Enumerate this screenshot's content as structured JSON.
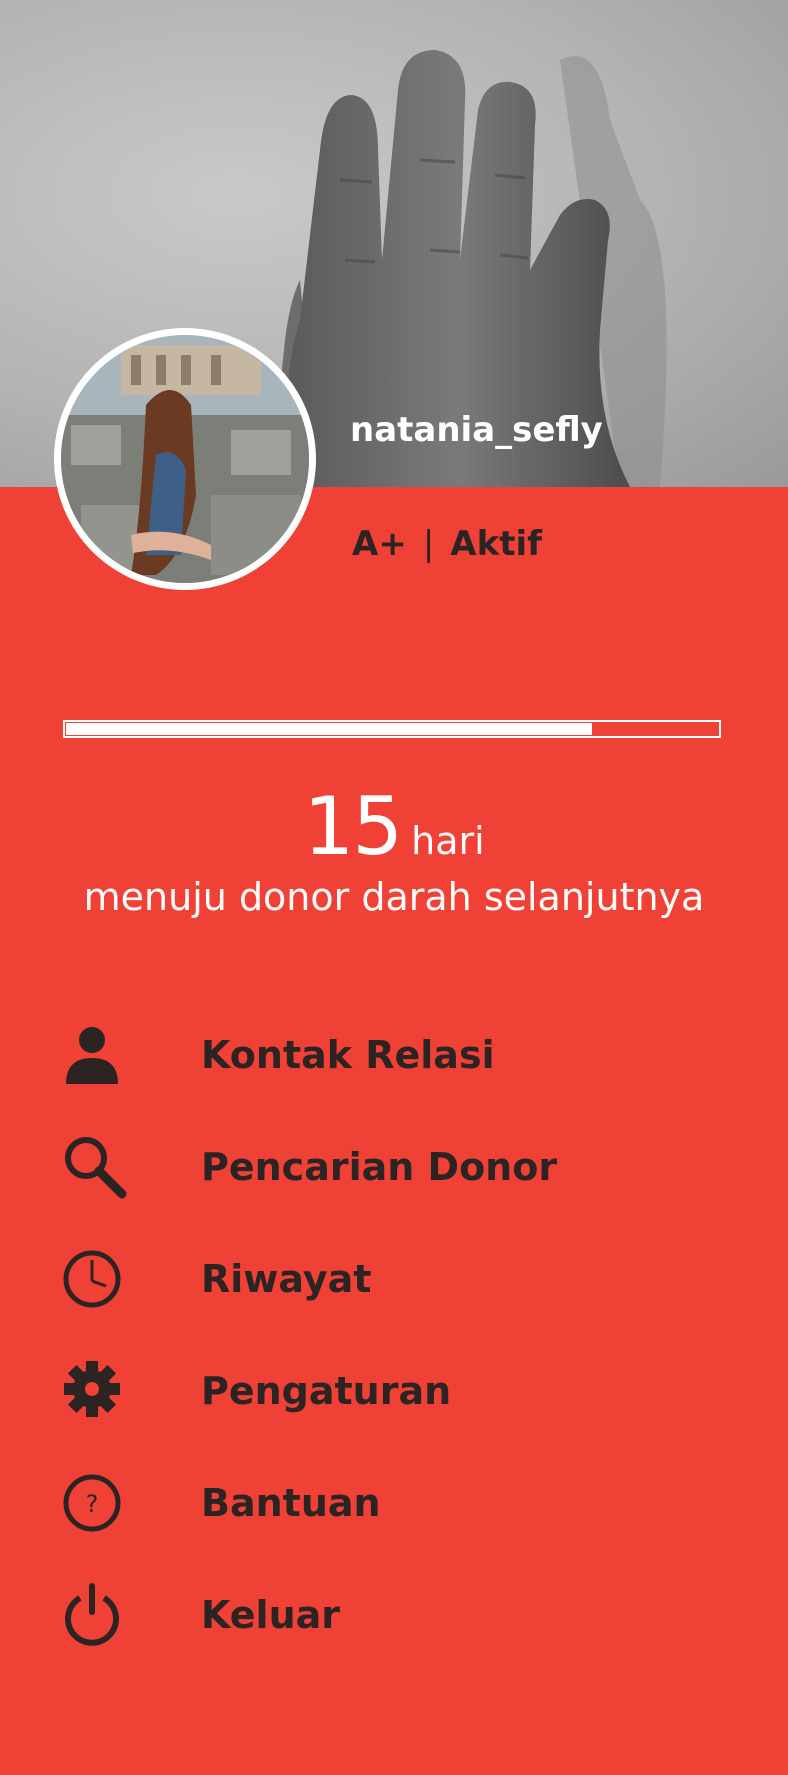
{
  "profile": {
    "username": "natania_sefly",
    "blood_type": "A+",
    "separator": "|",
    "status": "Aktif"
  },
  "donation": {
    "progress": 0.805,
    "days": "15",
    "days_unit": "hari",
    "caption": "menuju donor darah selanjutnya"
  },
  "menu": [
    {
      "label": "Kontak Relasi",
      "icon": "person-icon"
    },
    {
      "label": "Pencarian Donor",
      "icon": "search-icon"
    },
    {
      "label": "Riwayat",
      "icon": "clock-icon"
    },
    {
      "label": "Pengaturan",
      "icon": "gear-icon"
    },
    {
      "label": "Bantuan",
      "icon": "help-icon"
    },
    {
      "label": "Keluar",
      "icon": "power-icon"
    }
  ],
  "colors": {
    "background": "#ef4135",
    "dark_text": "#2b2422",
    "light_text": "#ffffff"
  }
}
